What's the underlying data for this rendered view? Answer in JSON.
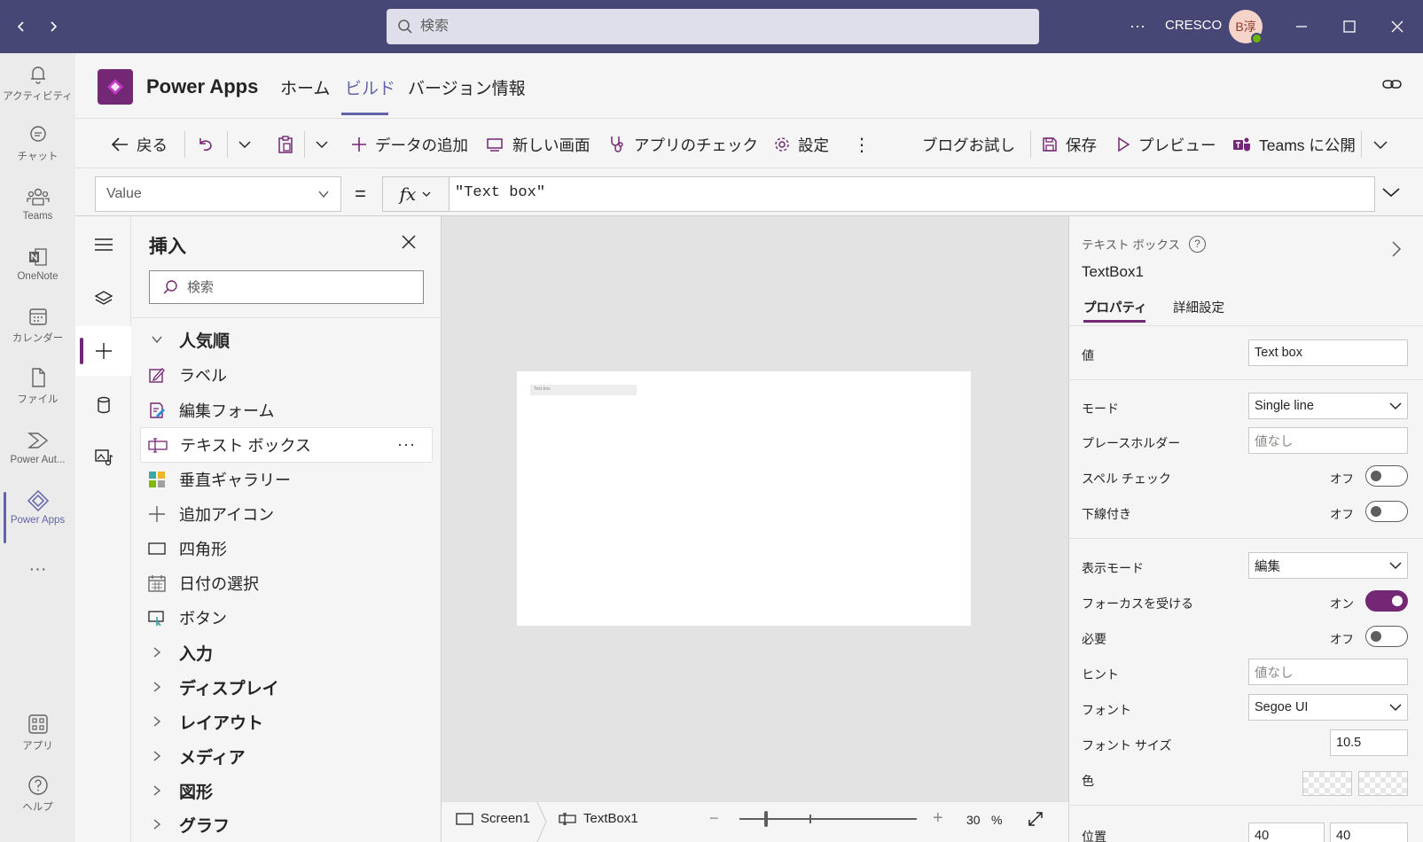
{
  "titlebar": {
    "search_placeholder": "検索",
    "more": "···",
    "org": "CRESCO",
    "avatar_initials": "B淳",
    "colors": {
      "bg": "#464775",
      "search_bg": "#dfdfeb"
    }
  },
  "rail": {
    "items": [
      {
        "label": "アクティビティ",
        "icon": "bell-icon"
      },
      {
        "label": "チャット",
        "icon": "chat-icon"
      },
      {
        "label": "Teams",
        "icon": "teams-icon"
      },
      {
        "label": "OneNote",
        "icon": "onenote-icon"
      },
      {
        "label": "カレンダー",
        "icon": "calendar-icon"
      },
      {
        "label": "ファイル",
        "icon": "file-icon"
      },
      {
        "label": "Power Aut...",
        "icon": "power-automate-icon"
      },
      {
        "label": "Power Apps",
        "icon": "power-apps-icon",
        "active": true
      },
      {
        "label": "···",
        "icon": "more-icon"
      }
    ],
    "bottom": [
      {
        "label": "アプリ",
        "icon": "apps-icon"
      },
      {
        "label": "ヘルプ",
        "icon": "help-icon"
      }
    ],
    "accent": "#6264a7"
  },
  "header": {
    "app_name": "Power Apps",
    "tabs": [
      {
        "label": "ホーム"
      },
      {
        "label": "ビルド",
        "active": true
      },
      {
        "label": "バージョン情報"
      }
    ],
    "brand_color": "#742774"
  },
  "commandbar": {
    "back": "戻る",
    "add_data": "データの追加",
    "new_screen": "新しい画面",
    "app_checker": "アプリのチェック",
    "settings": "設定",
    "more": "⋮",
    "blog_try": "ブログお試し",
    "save": "保存",
    "preview": "プレビュー",
    "publish": "Teams に公開"
  },
  "formulabar": {
    "property": "Value",
    "equals": "=",
    "fx": "fx",
    "formula": "\"Text box\""
  },
  "insert": {
    "title": "挿入",
    "search_placeholder": "検索",
    "items": [
      {
        "label": "人気順",
        "type": "category-open"
      },
      {
        "label": "ラベル",
        "icon": "label-edit-icon"
      },
      {
        "label": "編集フォーム",
        "icon": "edit-form-icon"
      },
      {
        "label": "テキスト ボックス",
        "icon": "text-box-icon",
        "more": "···"
      },
      {
        "label": "垂直ギャラリー",
        "icon": "gallery-icon"
      },
      {
        "label": "追加アイコン",
        "icon": "plus-icon"
      },
      {
        "label": "四角形",
        "icon": "rectangle-icon"
      },
      {
        "label": "日付の選択",
        "icon": "date-picker-icon"
      },
      {
        "label": "ボタン",
        "icon": "button-icon"
      },
      {
        "label": "入力",
        "type": "category"
      },
      {
        "label": "ディスプレイ",
        "type": "category"
      },
      {
        "label": "レイアウト",
        "type": "category"
      },
      {
        "label": "メディア",
        "type": "category"
      },
      {
        "label": "図形",
        "type": "category"
      },
      {
        "label": "グラフ",
        "type": "category"
      }
    ]
  },
  "canvas": {
    "textbox_text": "Text box",
    "status": {
      "screen": "Screen1",
      "control": "TextBox1",
      "zoom_minus": "−",
      "zoom_plus": "+",
      "zoom": "30",
      "zoom_unit": "%"
    }
  },
  "properties": {
    "type_label": "テキスト ボックス",
    "help": "?",
    "control_name": "TextBox1",
    "tabs": [
      "プロパティ",
      "詳細設定"
    ],
    "value_label": "値",
    "value": "Text box",
    "mode_label": "モード",
    "mode": "Single line",
    "placeholder_label": "プレースホルダー",
    "placeholder_value": "値なし",
    "spellcheck_label": "スペル チェック",
    "spellcheck_state": "オフ",
    "underline_label": "下線付き",
    "underline_state": "オフ",
    "display_mode_label": "表示モード",
    "display_mode": "編集",
    "focus_label": "フォーカスを受ける",
    "focus_state": "オン",
    "required_label": "必要",
    "required_state": "オフ",
    "hint_label": "ヒント",
    "hint_value": "値なし",
    "font_label": "フォント",
    "font": "Segoe UI",
    "font_size_label": "フォント サイズ",
    "font_size": "10.5",
    "color_label": "色",
    "position_label": "位置",
    "position_x": "40",
    "position_y": "40"
  }
}
